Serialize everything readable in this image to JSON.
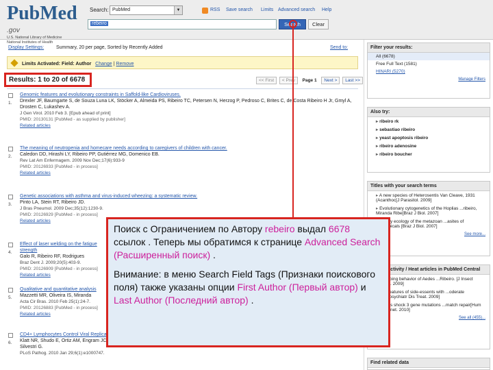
{
  "header": {
    "logo_text_a": "Pub",
    "logo_text_b": "Med",
    "logo_text_c": ".gov",
    "logo_sub_1": "U.S. National Library of Medicine",
    "logo_sub_2": "National Institutes of Health",
    "search_label": "Search:",
    "database_value": "PubMed",
    "links": [
      "RSS",
      "Save search",
      "Limits",
      "Advanced search",
      "Help"
    ],
    "search_value": "rebeiro",
    "search_button": "Search",
    "clear_button": "Clear"
  },
  "toolbar": {
    "display_settings": "Display Settings:",
    "display_summary": "Summary, 20 per page, Sorted by Recently Added",
    "send_to": "Send to:"
  },
  "limits": {
    "text": "Limits Activated: Field: Author",
    "change": "Change",
    "remove": "Remove"
  },
  "results": {
    "count_text": "Results: 1 to 20 of 6678",
    "pager": {
      "first": "<< First",
      "prev": "< Prev",
      "page": "Page 1",
      "next": "Next >",
      "last": "Last >>"
    }
  },
  "entries": [
    {
      "num": "1.",
      "title": "Genomic features and evolutionary constraints in Saffold-like Cardioviruses.",
      "authors": "Drexler JF, Baumgarte S, de Souza Luna LK, Stöcker A, Almeida PS, Ribeiro TC, Petersen N, Herzog P, Pedroso C, Brites C, de Costa Ribeiro H Jr, Gmyl A, Drosten C, Lukashev A.",
      "journal": "J Gen Virol. 2010 Feb 3. [Epub ahead of print]",
      "pmid": "PMID: 20130131 [PubMed - as supplied by publisher]",
      "related": "Related articles"
    },
    {
      "num": "2.",
      "title": "The meaning of neutropenia and homecare needs according to caregivers of children with cancer.",
      "authors": "Caledon DD, Hirashi LY, Ribeiro PP, Gutiérrez MG, Domenico EB.",
      "journal": "Rev Lat Am Enfermagem. 2009 Nov Dec;17(6):933-9",
      "pmid": "PMID: 20126933 [PubMed - in process]",
      "related": "Related articles"
    },
    {
      "num": "3.",
      "title": "Genetic associations with asthma and virus-induced wheezing: a systematic review.",
      "authors": "Pinto LA, Stein RT, Ribeiro JD.",
      "journal": "J Bras Pneumol. 2009 Dec;35(12):1230-9.",
      "pmid": "PMID: 20126929 [PubMed - in process]",
      "related": "Related articles"
    },
    {
      "num": "4.",
      "title": "Effect of laser welding on the fatigue strength",
      "authors": "Galo R, Ribeiro RF, Rodrigues",
      "journal": "Braz Dent J. 2009;20(5):403-9.",
      "pmid": "PMID: 20126909 [PubMed - in process]",
      "related": "Related articles"
    },
    {
      "num": "5.",
      "title": "Qualitative and quantitative analysis",
      "authors": "Mazzetti MR, Oliveira IS, Miranda",
      "journal": "Acta Cir Bras. 2010 Feb 25(1):24-7.",
      "pmid": "PMID: 20126883 [PubMed - in process]",
      "related": "Related articles"
    },
    {
      "num": "6.",
      "title": "CD4+ Lymphocytes Control Viral Replication in Productively Infected Cells.",
      "authors": "Klatt NR, Shudo E, Ortiz AM, Engram JC, Paiardini M, Lawson B, Miller MD, Else J, Pandrea I, Estes JD, Apetrei C, Schmitz JE, Ribeiro RM, Perelson AS, Silvestri G.",
      "journal": "PLoS Pathog. 2010 Jan 29;6(1):e1000747.",
      "pmid": "",
      "related": ""
    }
  ],
  "sidebar": {
    "filter": {
      "heading": "Filter your results:",
      "items": [
        "All (6678)",
        "Free Full Text (1581)",
        "HINARI (5270)"
      ],
      "manage": "Manage Filters"
    },
    "also_try": {
      "heading": "Also try:",
      "items": [
        "ribeiro rk",
        "sebastiao ribeiro",
        "yeast apoptosis ribeiro",
        "ribeiro adenosine",
        "ribeiro boucher"
      ]
    },
    "titles": {
      "heading": "Titles with your search terms",
      "items": [
        "A new species of Heterosentis Van Cleave, 1931 (Acanthoc[J Parasitol. 2009]",
        "Evolutionary cytogenetics of the Hoplias ...ribeiro, Miranda Ribe[Braz J Biol. 2007]",
        "...unity ecology of the metazoan ...asites of neotropicals [Braz J Biol. 2007]"
      ],
      "more": "See more..."
    },
    "heat": {
      "heading": "Recent activity / Heat articles in PubMed Central",
      "items": [
        "...probing behavior of Aedes ...Ribeiro. [J Insect Physiol. 2009]",
        "...al features of side-essents with ...oderate [Neuropsychiatr Dis Treat. 2009]",
        "...rless shock 3 gene mutations ...match repair[Hum Mol Genet. 2010]"
      ],
      "all": "See all (455)..."
    },
    "find_related": {
      "heading": "Find related data"
    }
  },
  "callout": {
    "p1_a": "Поиск с Ограничением по Автору",
    "p1_b": "rebeiro",
    "p1_c": "выдал",
    "p1_d": "6678",
    "p1_e": "ссылок . Теперь мы обратимся к странице",
    "p1_f": "Advanced Search (Расширенный поиск)",
    "p1_g": ".",
    "p2_a": "Внимание: в меню Search Field Tags (Признаки поискового поля) также указаны опции",
    "p2_b": "First Author (Первый автор)",
    "p2_c": "и",
    "p2_d": "Last Author (Последний автор)",
    "p2_e": "."
  },
  "colors": {
    "accent_red": "#d8241f",
    "callout_bg": "#e2ecf6",
    "highlight_magenta": "#cc1f9b",
    "link_blue": "#2255aa"
  }
}
